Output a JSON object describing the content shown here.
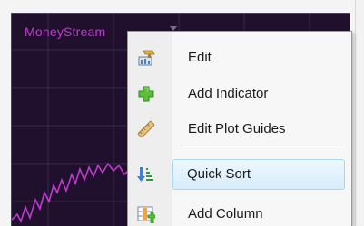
{
  "chart": {
    "title": "MoneyStream",
    "line_color": "#c03acf",
    "background_color": "#20102e"
  },
  "context_menu": {
    "items": [
      {
        "label": "Edit",
        "icon": "chart-edit-icon"
      },
      {
        "label": "Add Indicator",
        "icon": "green-plus-icon"
      },
      {
        "label": "Edit Plot Guides",
        "icon": "ruler-icon"
      },
      {
        "label": "Quick Sort",
        "icon": "sort-arrows-icon",
        "highlighted": true
      },
      {
        "label": "Add Column",
        "icon": "add-column-icon"
      }
    ]
  }
}
